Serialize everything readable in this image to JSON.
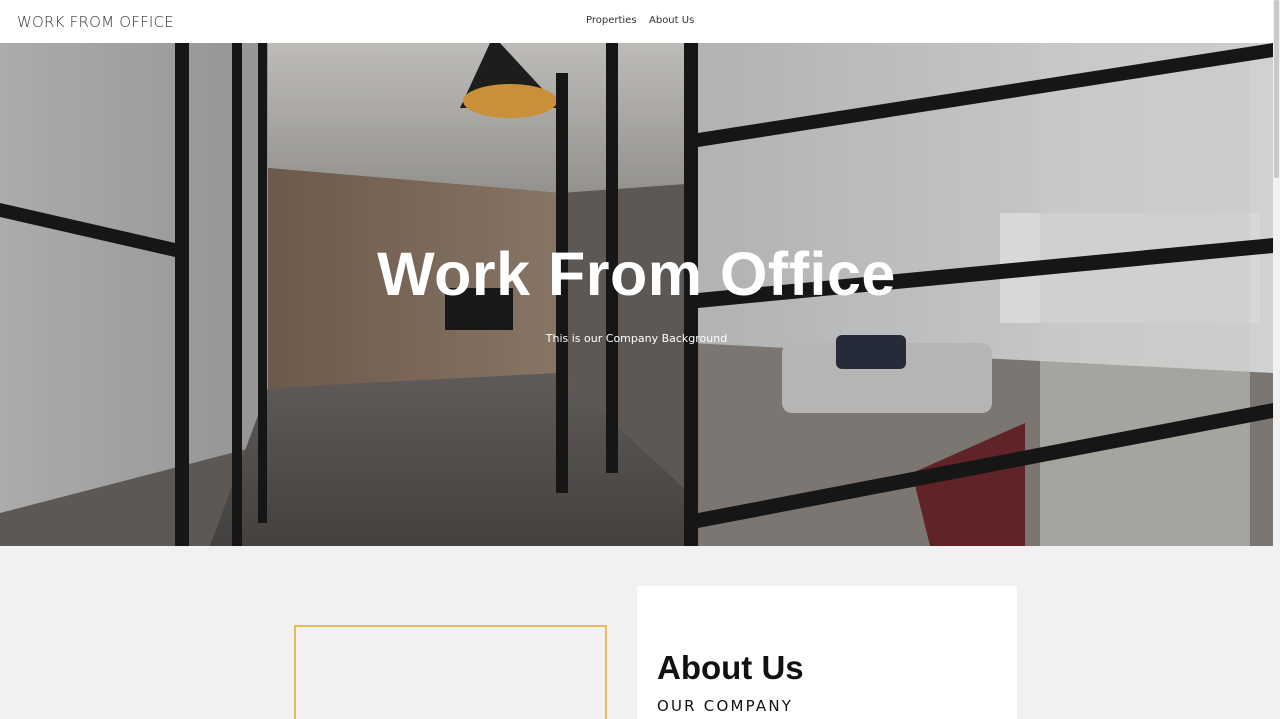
{
  "nav": {
    "brand": "WORK FROM OFFICE",
    "links": [
      "Properties",
      "About Us"
    ]
  },
  "hero": {
    "title": "Work From Office",
    "subtitle": "This is our Company Background"
  },
  "about": {
    "title": "About Us",
    "subtitle": "OUR COMPANY"
  },
  "colors": {
    "accent": "#e0bd56",
    "nav_bg": "#ffffff",
    "page_bg": "#f1f1f1"
  }
}
